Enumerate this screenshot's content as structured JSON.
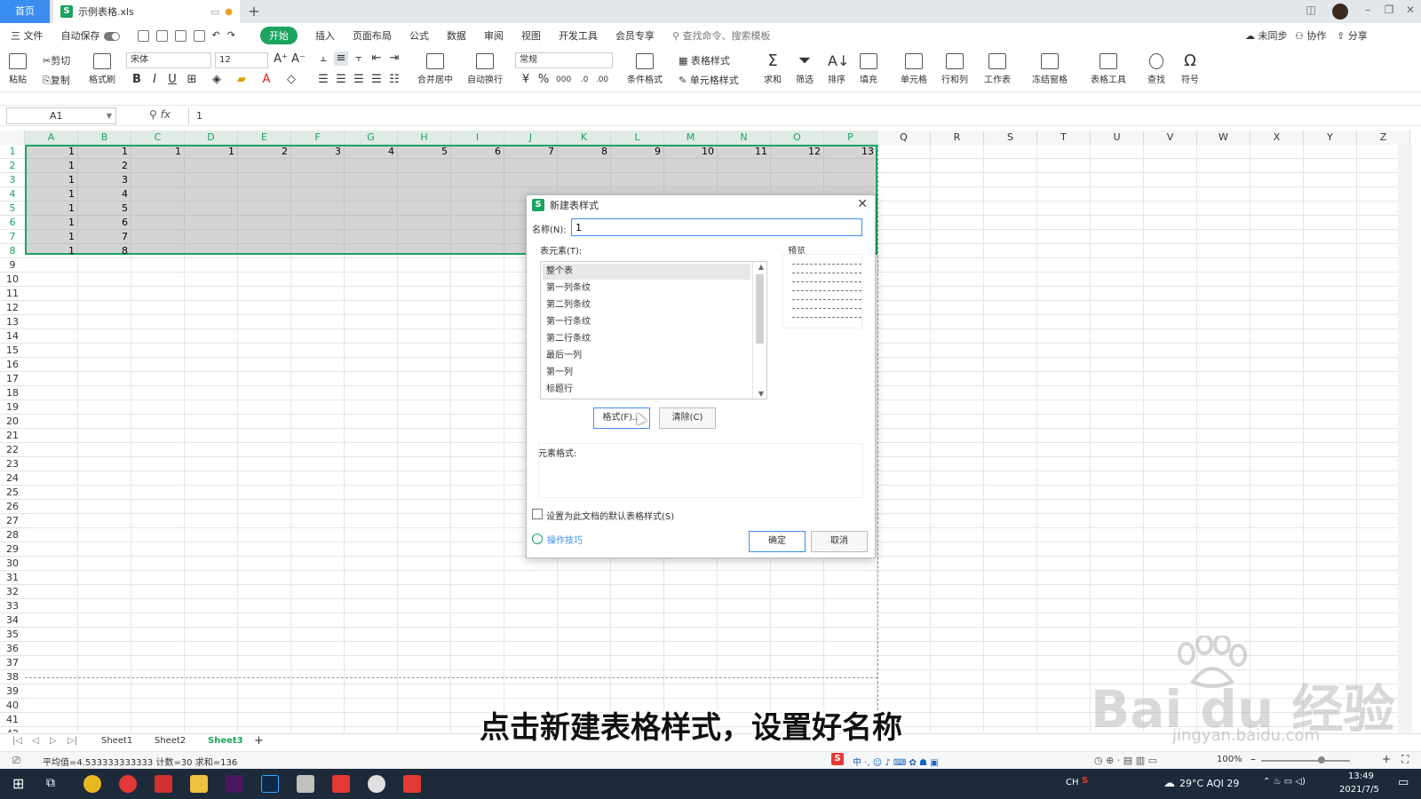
{
  "titlebar": {
    "home_tab": "首页",
    "doc_name": "示例表格.xls",
    "add": "+"
  },
  "menu": {
    "file": "三 文件",
    "autosave": "自动保存",
    "tabs": [
      "开始",
      "插入",
      "页面布局",
      "公式",
      "数据",
      "审阅",
      "视图",
      "开发工具",
      "会员专享"
    ],
    "active_tab": "开始",
    "search": "查找命令、搜索模板",
    "right": [
      "未同步",
      "协作",
      "分享"
    ]
  },
  "ribbon": {
    "paste": "粘贴",
    "cut": "剪切",
    "copy": "复制",
    "format_painter": "格式刷",
    "font": "宋体",
    "font_size": "12",
    "bold": "B",
    "italic": "I",
    "underline": "U",
    "merge": "合并居中",
    "wrap": "自动换行",
    "number_format": "常规",
    "currency": "¥",
    "percent": "%",
    "cond_format": "条件格式",
    "table_style": "表格样式",
    "cell_style": "单元格样式",
    "sum": "求和",
    "filter": "筛选",
    "sort": "排序",
    "fill": "填充",
    "cell": "单元格",
    "rowcol": "行和列",
    "worksheet": "工作表",
    "freeze": "冻结窗格",
    "table_tools": "表格工具",
    "find": "查找",
    "symbol": "符号"
  },
  "formula": {
    "cell_ref": "A1",
    "fx": "fx",
    "value": "1"
  },
  "grid": {
    "columns": [
      "A",
      "B",
      "C",
      "D",
      "E",
      "F",
      "G",
      "H",
      "I",
      "J",
      "K",
      "L",
      "M",
      "N",
      "O",
      "P",
      "Q",
      "R",
      "S",
      "T",
      "U",
      "V",
      "W",
      "X",
      "Y",
      "Z"
    ],
    "row_count": 42,
    "rows": [
      [
        "1",
        "1",
        "1",
        "1",
        "2",
        "3",
        "4",
        "5",
        "6",
        "7",
        "8",
        "9",
        "10",
        "11",
        "12",
        "13"
      ],
      [
        "1",
        "2"
      ],
      [
        "1",
        "3"
      ],
      [
        "1",
        "4"
      ],
      [
        "1",
        "5"
      ],
      [
        "1",
        "6"
      ],
      [
        "1",
        "7"
      ],
      [
        "1",
        "8"
      ]
    ]
  },
  "dialog": {
    "title": "新建表样式",
    "name_label": "名称(N):",
    "name_value": "1",
    "elements_label": "表元素(T):",
    "preview_label": "预览",
    "elements": [
      "整个表",
      "第一列条纹",
      "第二列条纹",
      "第一行条纹",
      "第二行条纹",
      "最后一列",
      "第一列",
      "标题行"
    ],
    "selected_element": "整个表",
    "format_button": "格式(F)...",
    "clear_button": "清除(C)",
    "element_format_label": "元素格式:",
    "default_checkbox": "设置为此文档的默认表格样式(S)",
    "tips_link": "操作技巧",
    "ok": "确定",
    "cancel": "取消"
  },
  "sheets": {
    "tabs": [
      "Sheet1",
      "Sheet2",
      "Sheet3"
    ],
    "active": "Sheet3",
    "add": "+"
  },
  "status": {
    "summary": "平均值=4.533333333333  计数=30  求和=136",
    "zoom": "100%"
  },
  "taskbar": {
    "weather": "29°C AQI 29",
    "time": "13:49",
    "date": "2021/7/5",
    "ime": "CH"
  },
  "subtitle": "点击新建表格样式，设置好名称",
  "watermark": {
    "logo": "Bai du 经验",
    "url": "jingyan.baidu.com"
  }
}
